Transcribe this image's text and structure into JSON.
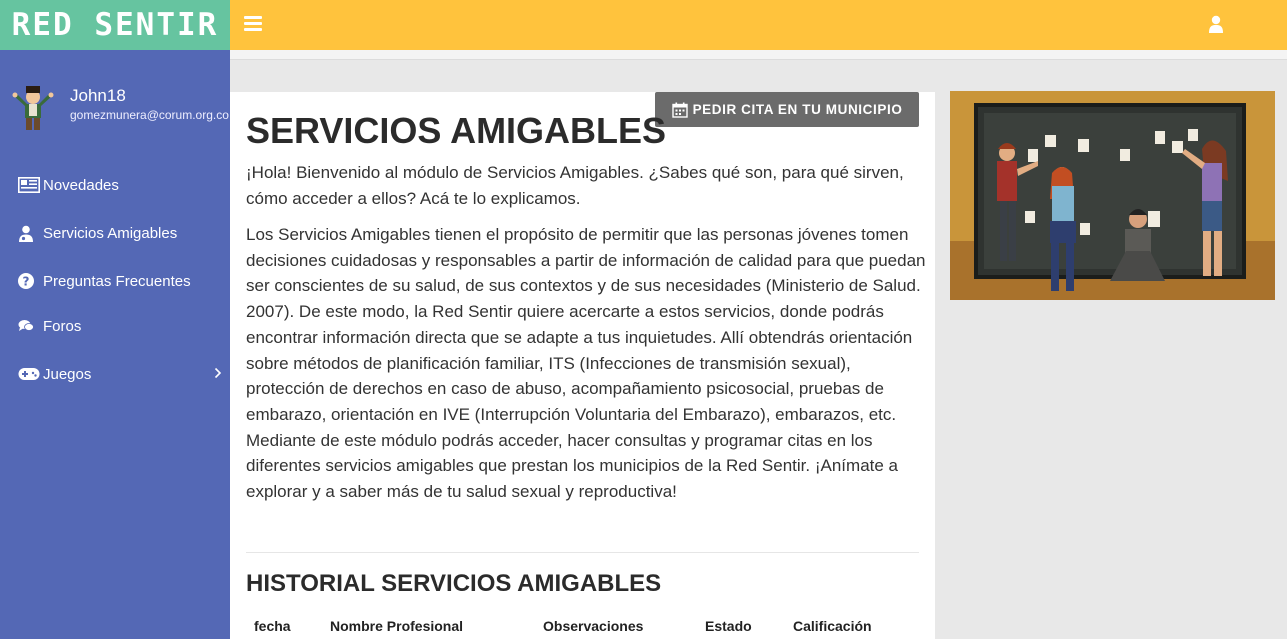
{
  "brand": {
    "name": "RED SENTIR"
  },
  "topbar": {
    "menu_icon": "hamburger-icon",
    "user_icon": "user-icon"
  },
  "user": {
    "name": "John18",
    "email": "gomezmunera@corum.org.co"
  },
  "sidebar": {
    "items": [
      {
        "label": "Novedades",
        "icon": "newspaper-icon"
      },
      {
        "label": "Servicios Amigables",
        "icon": "user-md-icon"
      },
      {
        "label": "Preguntas Frecuentes",
        "icon": "question-circle-icon"
      },
      {
        "label": "Foros",
        "icon": "comments-icon"
      },
      {
        "label": "Juegos",
        "icon": "gamepad-icon",
        "has_submenu": true
      }
    ]
  },
  "main": {
    "cita_button": "PEDIR CITA EN TU MUNICIPIO",
    "title": "SERVICIOS AMIGABLES",
    "intro": "¡Hola! Bienvenido al módulo de Servicios Amigables. ¿Sabes qué son, para qué sirven, cómo acceder a ellos? Acá te lo explicamos.",
    "body": "Los Servicios Amigables tienen el propósito de permitir que las personas jóvenes tomen decisiones cuidadosas y responsables a partir de información de calidad para que puedan ser conscientes de su salud, de sus contextos y de sus necesidades (Ministerio de Salud. 2007). De este modo, la Red Sentir quiere acercarte a estos servicios, donde podrás encontrar información directa que se adapte a tus inquietudes. Allí obtendrás orientación sobre métodos de planificación familiar, ITS (Infecciones de transmisión sexual), protección de derechos en caso de abuso, acompañamiento psicosocial, pruebas de embarazo, orientación en IVE (Interrupción Voluntaria del Embarazo), embarazos, etc. Mediante de este módulo podrás acceder, hacer consultas y programar citas en los diferentes servicios amigables que prestan los municipios de la Red Sentir. ¡Anímate a explorar y a saber más de tu salud sexual y reproductiva!",
    "history_title": "HISTORIAL SERVICIOS AMIGABLES",
    "table_headers": [
      "fecha",
      "Nombre Profesional",
      "Observaciones",
      "Estado",
      "Calificación"
    ]
  },
  "colors": {
    "brand_bg": "#66c4a0",
    "topbar_bg": "#ffc33d",
    "sidebar_bg": "#5468b5",
    "button_bg": "#6b6b6b"
  }
}
